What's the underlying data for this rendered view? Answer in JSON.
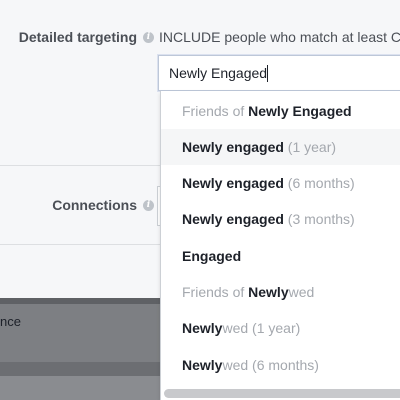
{
  "detailed_targeting": {
    "label": "Detailed targeting",
    "info_icon": "i",
    "include_text": "INCLUDE people who match at least C"
  },
  "search": {
    "value": "Newly Engaged"
  },
  "dropdown": {
    "items": [
      {
        "prefix": "Friends of ",
        "bold": "Newly Engaged",
        "suffix": "",
        "type": "header"
      },
      {
        "prefix": "",
        "bold": "Newly engaged",
        "suffix": " (1 year)",
        "type": "option",
        "highlighted": true
      },
      {
        "prefix": "",
        "bold": "Newly engaged",
        "suffix": " (6 months)",
        "type": "option"
      },
      {
        "prefix": "",
        "bold": "Newly engaged",
        "suffix": " (3 months)",
        "type": "option"
      },
      {
        "prefix": "",
        "bold": "Engaged",
        "suffix": "",
        "type": "option"
      },
      {
        "prefix": "Friends of ",
        "bold": "Newly",
        "suffix": "wed",
        "type": "header"
      },
      {
        "prefix": "",
        "bold": "Newly",
        "suffix": "wed (1 year)",
        "type": "option"
      },
      {
        "prefix": "",
        "bold": "Newly",
        "suffix": "wed (6 months)",
        "type": "option"
      }
    ]
  },
  "connections": {
    "label": "Connections",
    "info_icon": "i"
  },
  "background_panel": {
    "text": "nce"
  },
  "colors": {
    "accent": "#4267b2",
    "text_dark": "#1d2129",
    "text_muted": "#a4a8ae",
    "highlight": "#f5f6f7"
  }
}
